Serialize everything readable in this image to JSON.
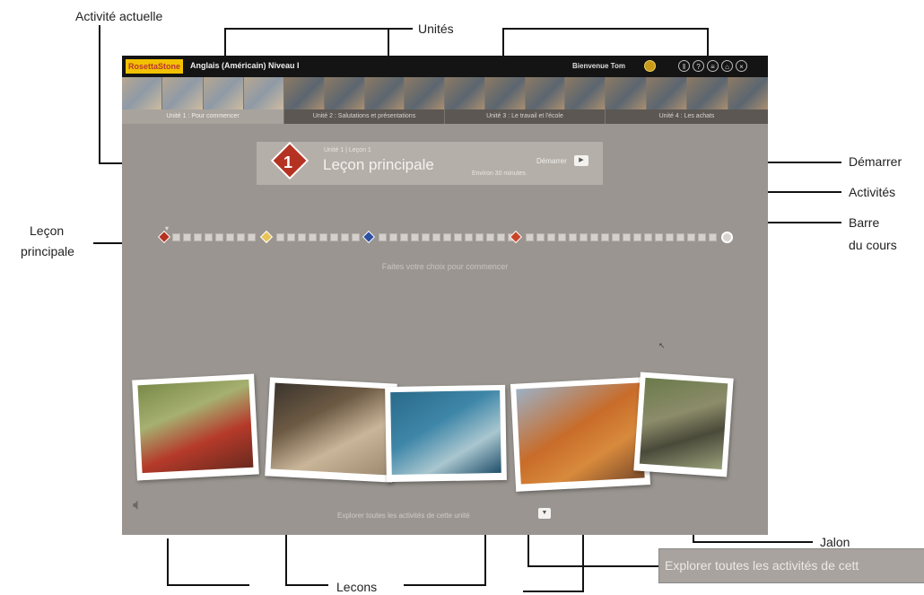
{
  "annotations": {
    "current_activity": "Activité actuelle",
    "units": "Unités",
    "start": "Démarrer",
    "activities": "Activités",
    "course_bar_line1": "Barre",
    "course_bar_line2": "du cours",
    "core_lesson_line1": "Leçon",
    "core_lesson_line2": "principale",
    "milestone": "Jalon",
    "lessons": "Lecons",
    "explore_zoom": "Explorer toutes les activités de cett"
  },
  "app": {
    "logo": "RosettaStone",
    "course_title": "Anglais (Américain) Niveau I",
    "welcome": "Bienvenue Tom",
    "top_icons": [
      "coin-icon",
      "pause-icon",
      "help-icon",
      "settings-icon",
      "home-icon",
      "close-icon"
    ],
    "units": [
      {
        "label": "Unité 1 : Pour commencer",
        "active": true
      },
      {
        "label": "Unité 2 : Salutations et présentations",
        "active": false
      },
      {
        "label": "Unité 3 : Le travail et l'école",
        "active": false
      },
      {
        "label": "Unité 4 : Les achats",
        "active": false
      }
    ],
    "lesson": {
      "number": "1",
      "subtitle": "Unité 1 | Leçon 1",
      "title": "Leçon principale",
      "duration": "Environ 30 minutes",
      "start_label": "Démarrer"
    },
    "hint": "Faites votre choix pour commencer",
    "explore_text": "Explorer toutes les activités de cette unité",
    "course_bar": {
      "lesson_colors": [
        "#b53222",
        "#e8c35a",
        "#2f4fa0",
        "#c9452a"
      ],
      "squares_per_lesson": [
        5,
        5,
        9,
        8
      ]
    },
    "photos": [
      {
        "subject": "girl-in-sweater"
      },
      {
        "subject": "family-reading-newspaper"
      },
      {
        "subject": "tropical-fish"
      },
      {
        "subject": "group-of-friends"
      },
      {
        "subject": "coffee-mug-milestone"
      }
    ]
  },
  "colors": {
    "app_bg": "#9a9590",
    "topbar": "#141414",
    "logo_bg": "#f2c200",
    "lesson_red": "#b53222"
  }
}
